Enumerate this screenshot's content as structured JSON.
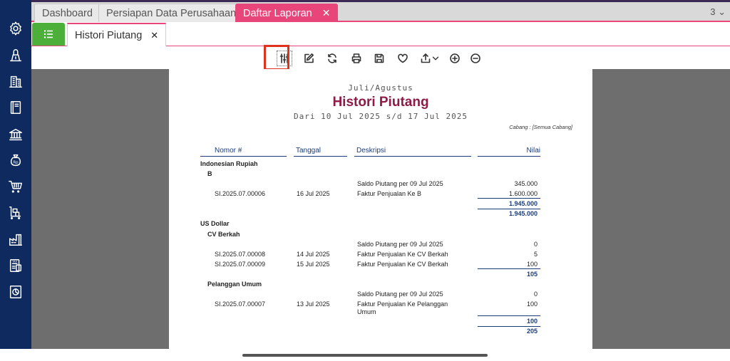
{
  "tabs": [
    {
      "label": "Dashboard"
    },
    {
      "label": "Persiapan Data Perusahaan"
    },
    {
      "label": "Daftar Laporan"
    }
  ],
  "tab_count": "3 ⌄",
  "subtab": {
    "label": "Histori Piutang"
  },
  "report": {
    "period": "Juli/Agustus",
    "title": "Histori Piutang",
    "range": "Dari 10 Jul 2025 s/d 17 Jul 2025",
    "branch": "Cabang : [Semua Cabang]",
    "columns": {
      "nomor": "Nomor #",
      "tanggal": "Tanggal",
      "deskripsi": "Deskripsi",
      "nilai": "Nilai"
    },
    "groups": [
      {
        "currency": "Indonesian Rupiah",
        "customers": [
          {
            "name": "B",
            "rows": [
              {
                "nomor": "",
                "tanggal": "",
                "deskripsi": "Saldo Piutang per 09 Jul 2025",
                "nilai": "345.000"
              },
              {
                "nomor": "SI.2025.07.00006",
                "tanggal": "16 Jul 2025",
                "deskripsi": "Faktur Penjualan Ke B",
                "nilai": "1.600.000"
              }
            ],
            "subtotal": "1.945.000"
          }
        ],
        "total": "1.945.000"
      },
      {
        "currency": "US Dollar",
        "customers": [
          {
            "name": "CV Berkah",
            "rows": [
              {
                "nomor": "",
                "tanggal": "",
                "deskripsi": "Saldo Piutang per 09 Jul 2025",
                "nilai": "0"
              },
              {
                "nomor": "SI.2025.07.00008",
                "tanggal": "14 Jul 2025",
                "deskripsi": "Faktur Penjualan Ke CV Berkah",
                "nilai": "5"
              },
              {
                "nomor": "SI.2025.07.00009",
                "tanggal": "15 Jul 2025",
                "deskripsi": "Faktur Penjualan Ke CV Berkah",
                "nilai": "100"
              }
            ],
            "subtotal": "105"
          },
          {
            "name": "Pelanggan Umum",
            "rows": [
              {
                "nomor": "",
                "tanggal": "",
                "deskripsi": "Saldo Piutang per 09 Jul 2025",
                "nilai": "0"
              },
              {
                "nomor": "SI.2025.07.00007",
                "tanggal": "13 Jul 2025",
                "deskripsi": "Faktur Penjualan Ke Pelanggan",
                "deskripsi2": "Umum",
                "nilai": "100"
              }
            ],
            "subtotal": "100"
          }
        ],
        "total": "205"
      }
    ]
  },
  "toolbar_icons": [
    "sliders-icon",
    "edit-icon",
    "refresh-icon",
    "print-icon",
    "save-icon",
    "heart-icon",
    "export-icon",
    "zoom-in-icon",
    "zoom-out-icon"
  ],
  "sidebar_icons": [
    "settings-icon",
    "scale-icon",
    "building-icon",
    "book-icon",
    "bank-icon",
    "money-bag-icon",
    "cart-icon",
    "delivery-icon",
    "factory-icon",
    "tax-icon",
    "report-icon"
  ],
  "colors": {
    "accent": "#e8457a",
    "sidebar": "#0e2a5e",
    "title": "#8f1a46",
    "header_blue": "#1a3d7a",
    "menu_green": "#4caf3a",
    "highlight": "#e0301e"
  }
}
